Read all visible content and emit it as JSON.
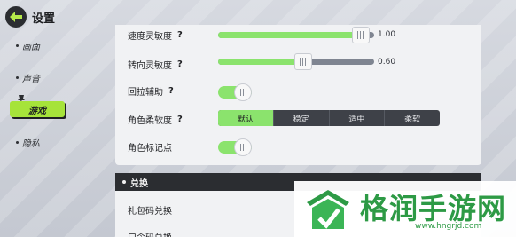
{
  "header": {
    "title": "设置"
  },
  "sidebar": {
    "items": [
      {
        "label": "画面"
      },
      {
        "label": "声音"
      },
      {
        "label": "游戏"
      },
      {
        "label": "隐私"
      }
    ]
  },
  "settings": {
    "speed_sensitivity": {
      "label": "速度灵敏度",
      "help": "?",
      "value": 1.0,
      "display": "1.00"
    },
    "turn_sensitivity": {
      "label": "转向灵敏度",
      "help": "?",
      "value": 0.6,
      "display": "0.60"
    },
    "return_assist": {
      "label": "回拉辅助",
      "help": "?",
      "on": true
    },
    "softness": {
      "label": "角色柔软度",
      "help": "?",
      "options": [
        "默认",
        "稳定",
        "适中",
        "柔软"
      ],
      "selected": "默认"
    },
    "marker": {
      "label": "角色标记点",
      "on": true
    }
  },
  "exchange": {
    "title": "兑换",
    "rows": [
      "礼包码兑换",
      "口令码兑换"
    ]
  },
  "watermark": {
    "name": "格润手游网",
    "url": "www.hngrjd.com"
  },
  "colors": {
    "accent": "#8be36d",
    "active_tab": "#a6e33a",
    "dark": "#2b2d31"
  }
}
